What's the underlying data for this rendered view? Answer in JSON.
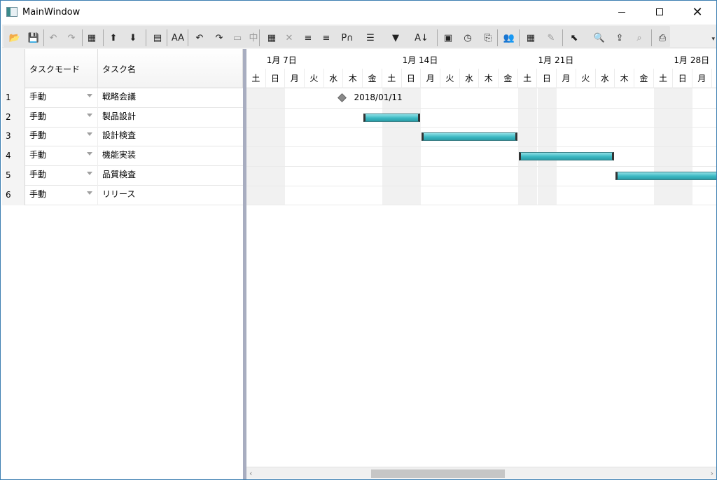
{
  "window": {
    "title": "MainWindow"
  },
  "toolbar": {
    "buttons": [
      {
        "name": "open-folder",
        "glyph": "📂"
      },
      {
        "name": "save",
        "glyph": "💾"
      },
      {
        "name": "undo",
        "glyph": "↶"
      },
      {
        "name": "redo",
        "glyph": "↷"
      },
      {
        "name": "grid-columns",
        "glyph": "▦"
      },
      {
        "name": "move-up",
        "glyph": "⬆"
      },
      {
        "name": "move-down",
        "glyph": "⬇"
      },
      {
        "name": "task-info",
        "glyph": "▤"
      },
      {
        "name": "font",
        "glyph": "AA"
      },
      {
        "name": "indent",
        "glyph": "↶"
      },
      {
        "name": "outdent",
        "glyph": "↷"
      },
      {
        "name": "link",
        "glyph": "▭"
      },
      {
        "name": "unlink",
        "glyph": "中"
      },
      {
        "name": "calendar",
        "glyph": "▦"
      },
      {
        "name": "delete",
        "glyph": "✕"
      },
      {
        "name": "insert-below",
        "glyph": "≡"
      },
      {
        "name": "insert-above",
        "glyph": "≡"
      },
      {
        "name": "pi",
        "glyph": "P∩"
      },
      {
        "name": "outline",
        "glyph": "☰"
      },
      {
        "name": "filter",
        "glyph": "▼"
      },
      {
        "name": "sort",
        "glyph": "A↓"
      },
      {
        "name": "task-details",
        "glyph": "▣"
      },
      {
        "name": "schedule",
        "glyph": "◷"
      },
      {
        "name": "copy-format",
        "glyph": "⎘"
      },
      {
        "name": "resources",
        "glyph": "👥"
      },
      {
        "name": "search-table",
        "glyph": "▦"
      },
      {
        "name": "brush",
        "glyph": "✎"
      },
      {
        "name": "select",
        "glyph": "⬉"
      },
      {
        "name": "zoom",
        "glyph": "🔍"
      },
      {
        "name": "export",
        "glyph": "⇪"
      },
      {
        "name": "preview",
        "glyph": "⌕"
      },
      {
        "name": "print",
        "glyph": "⎙"
      }
    ],
    "overflow_glyph": "▾"
  },
  "grid": {
    "headers": {
      "mode": "タスクモード",
      "name": "タスク名"
    },
    "rows": [
      {
        "num": "1",
        "mode": "手動",
        "name": "戦略会議"
      },
      {
        "num": "2",
        "mode": "手動",
        "name": "製品設計"
      },
      {
        "num": "3",
        "mode": "手動",
        "name": "設計検査"
      },
      {
        "num": "4",
        "mode": "手動",
        "name": "機能実装"
      },
      {
        "num": "5",
        "mode": "手動",
        "name": "品質検査"
      },
      {
        "num": "6",
        "mode": "手動",
        "name": "リリース"
      }
    ]
  },
  "gantt": {
    "weeks": [
      {
        "label": "1月 7日",
        "day_index": 1
      },
      {
        "label": "1月 14日",
        "day_index": 8
      },
      {
        "label": "1月 21日",
        "day_index": 15
      },
      {
        "label": "1月 28日",
        "day_index": 22
      }
    ],
    "days": [
      "土",
      "日",
      "月",
      "火",
      "水",
      "木",
      "金",
      "土",
      "日",
      "月",
      "火",
      "水",
      "木",
      "金",
      "土",
      "日",
      "月",
      "火",
      "水",
      "木",
      "金",
      "土",
      "日",
      "月"
    ],
    "weekend_indices": [
      0,
      1,
      7,
      8,
      14,
      15,
      21,
      22
    ],
    "milestone": {
      "row": 0,
      "day": 5,
      "label": "2018/01/11"
    },
    "bars": [
      {
        "row": 1,
        "start": 6,
        "end": 9
      },
      {
        "row": 2,
        "start": 9,
        "end": 14
      },
      {
        "row": 3,
        "start": 14,
        "end": 19
      },
      {
        "row": 4,
        "start": 19,
        "end": 25
      }
    ],
    "scroll_left": "‹",
    "scroll_right": "›"
  }
}
